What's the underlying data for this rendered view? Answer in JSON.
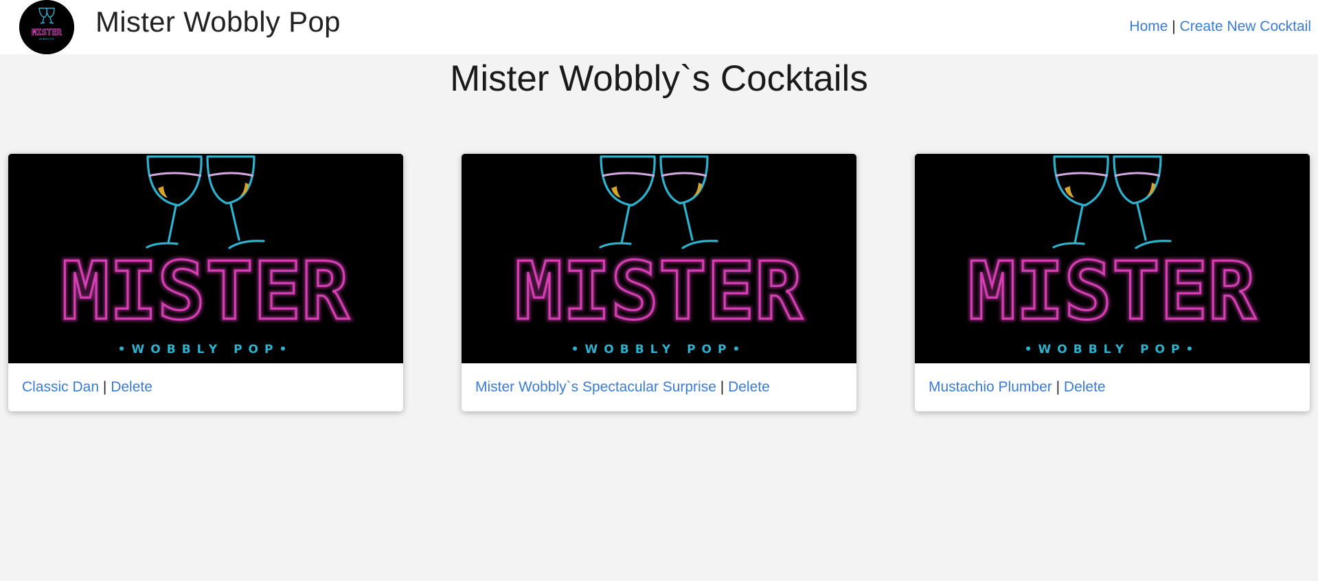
{
  "header": {
    "logo": {
      "icon": "mister-wobbly-pop-logo",
      "text": "MISTER",
      "subtext": "WOBBLY POP"
    },
    "site_title": "Mister Wobbly Pop",
    "nav": {
      "home": "Home",
      "separator": "|",
      "create": "Create New Cocktail"
    }
  },
  "main": {
    "page_title": "Mister Wobbly`s Cocktails",
    "cards": [
      {
        "image": {
          "text": "MISTER",
          "subtext": "•WOBBLY POP•"
        },
        "name": "Classic Dan",
        "separator": "|",
        "delete": "Delete"
      },
      {
        "image": {
          "text": "MISTER",
          "subtext": "•WOBBLY POP•"
        },
        "name": "Mister Wobbly`s Spectacular Surprise",
        "separator": "|",
        "delete": "Delete"
      },
      {
        "image": {
          "text": "MISTER",
          "subtext": "•WOBBLY POP•"
        },
        "name": "Mustachio Plumber",
        "separator": "|",
        "delete": "Delete"
      }
    ]
  },
  "colors": {
    "background": "#f3f3f3",
    "link": "#3a7bd5",
    "neon_pink": "#d63fb3",
    "neon_cyan": "#2bb3cf",
    "neon_gold": "#d4a52a"
  }
}
